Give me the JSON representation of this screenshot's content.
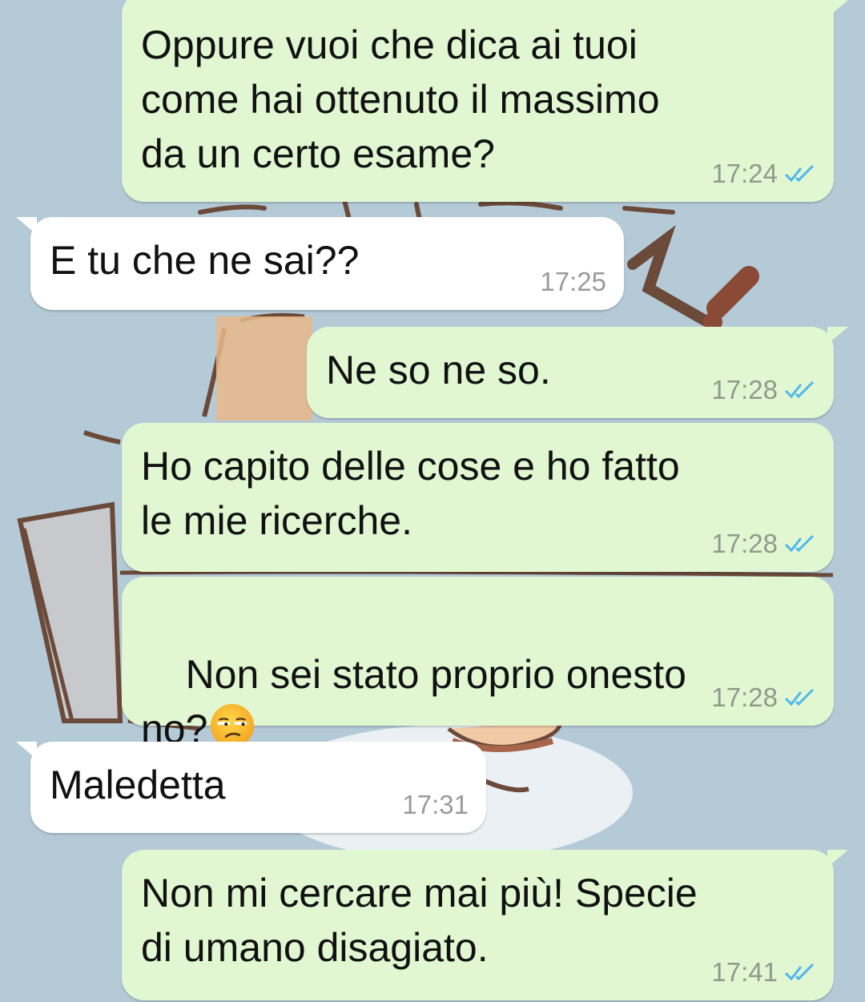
{
  "chat": {
    "messages": [
      {
        "direction": "out",
        "text": "Oppure vuoi che dica ai tuoi\ncome hai ottenuto il massimo\nda un certo esame?",
        "time": "17:24",
        "status_icon": "double-check-read-icon"
      },
      {
        "direction": "in",
        "text": "E tu che ne sai??",
        "time": "17:25"
      },
      {
        "direction": "out",
        "text": "Ne so ne so.",
        "time": "17:28",
        "status_icon": "double-check-read-icon"
      },
      {
        "direction": "out",
        "text": "Ho capito delle cose e ho fatto\nle mie ricerche.",
        "time": "17:28",
        "status_icon": "double-check-read-icon"
      },
      {
        "direction": "out",
        "text_line1": "Non sei stato proprio onesto",
        "text_line2": "no?",
        "emoji": "unamused-face-emoji",
        "time": "17:28",
        "status_icon": "double-check-read-icon"
      },
      {
        "direction": "in",
        "text": "Maledetta",
        "time": "17:31"
      },
      {
        "direction": "out",
        "text": "Non mi cercare mai più! Specie\ndi umano disagiato.",
        "time": "17:41",
        "status_icon": "double-check-read-icon"
      }
    ]
  },
  "colors": {
    "background": "#b4cad7",
    "outgoing_bubble": "#e1f7d2",
    "incoming_bubble": "#ffffff",
    "read_ticks": "#4fb6ec"
  }
}
